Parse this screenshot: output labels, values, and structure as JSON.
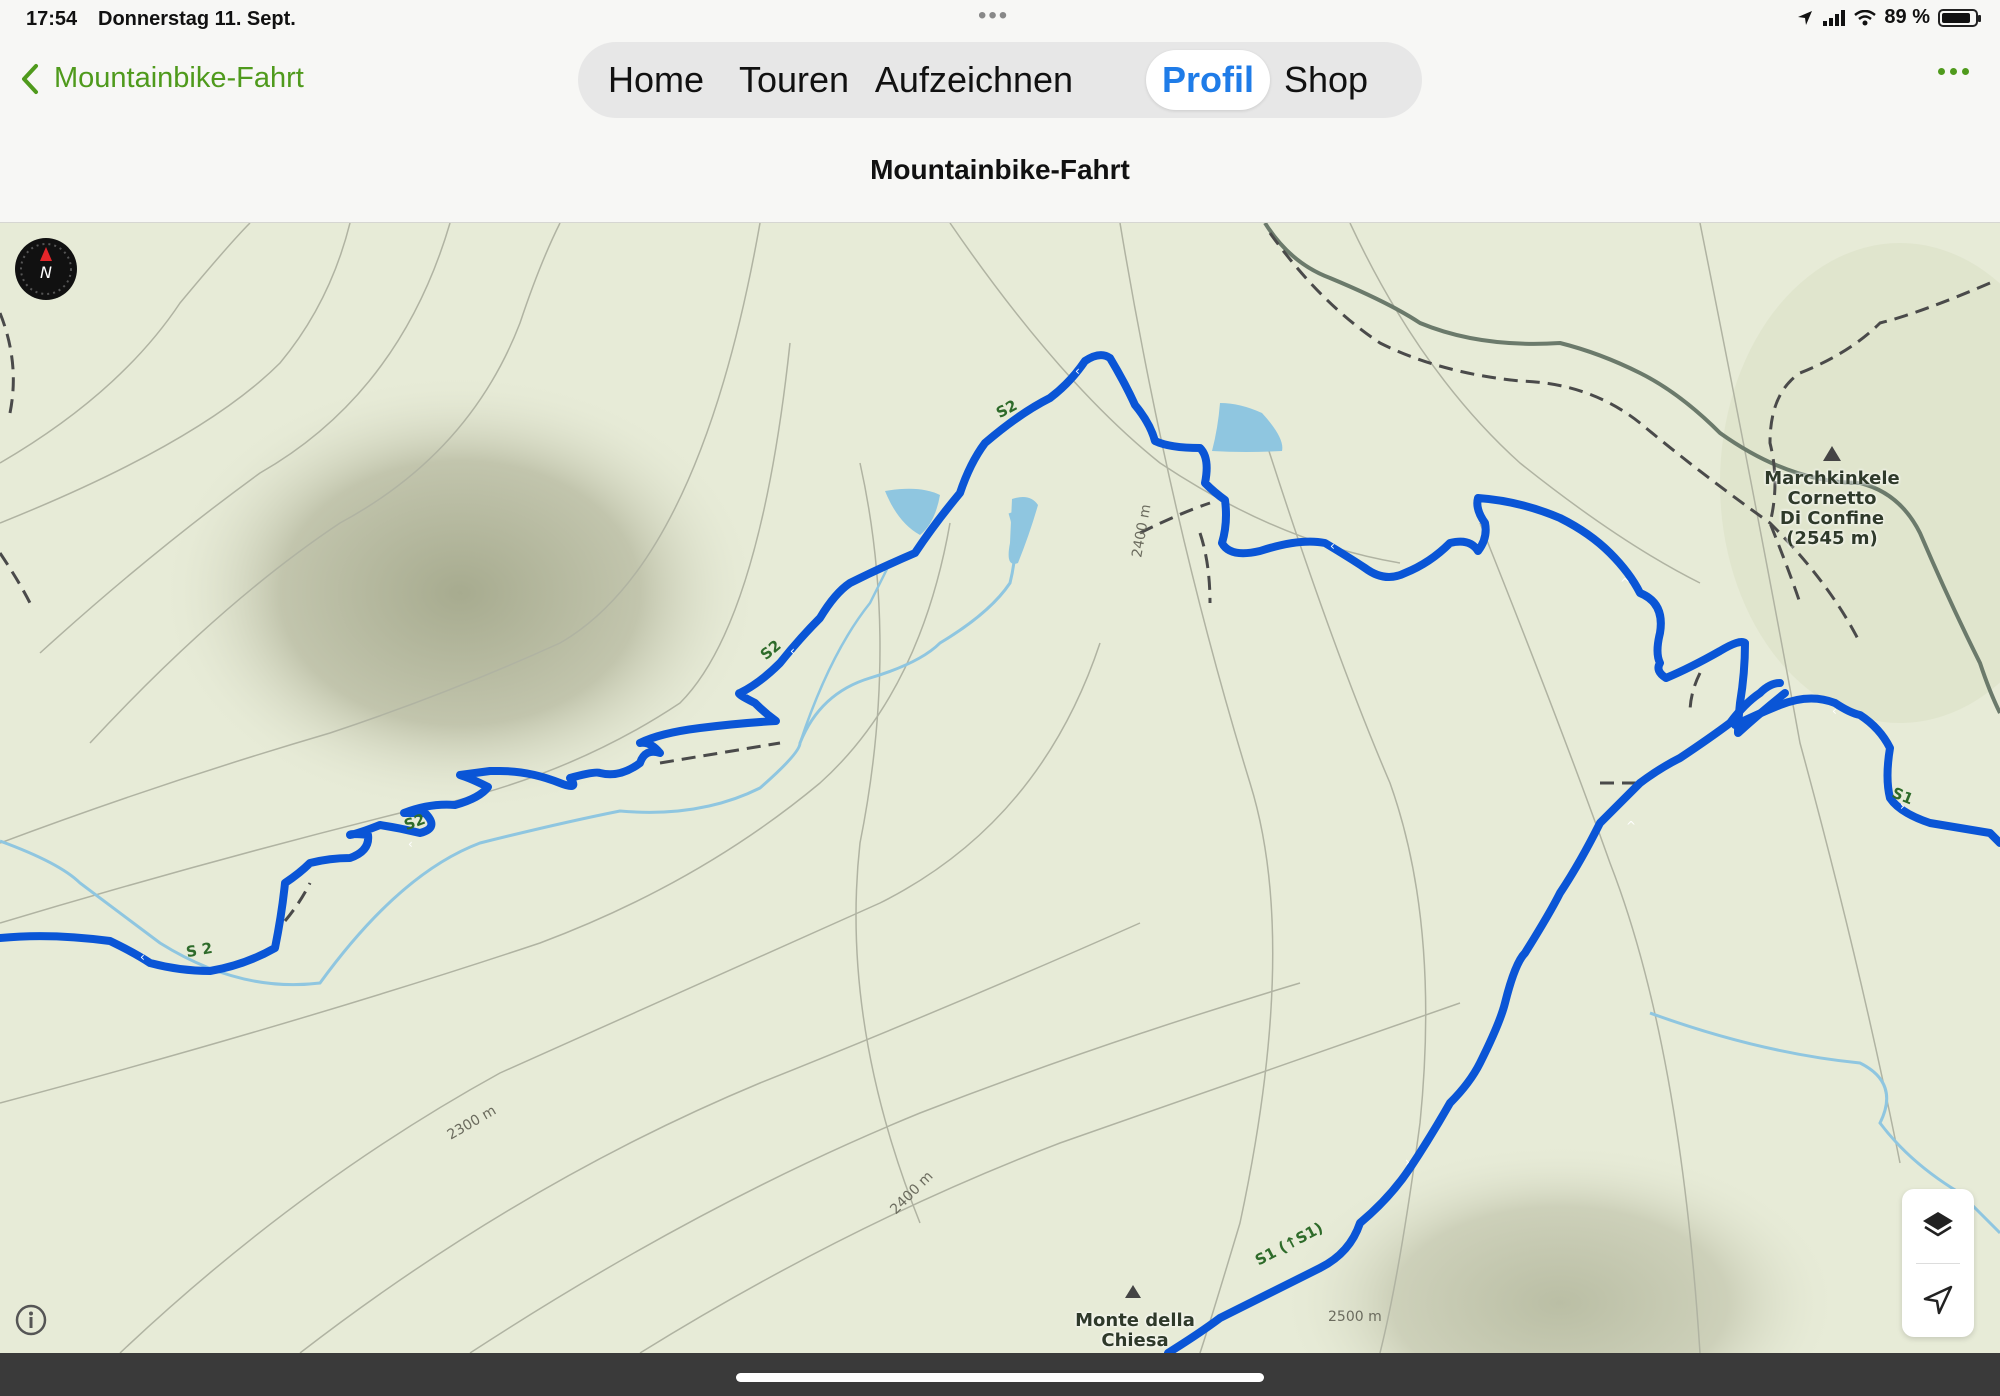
{
  "status_bar": {
    "time": "17:54",
    "date": "Donnerstag 11. Sept.",
    "battery_text": "89 %",
    "battery_level": 0.89
  },
  "nav": {
    "back_label": "Mountainbike-Fahrt",
    "tabs": [
      {
        "label": "Home",
        "active": false
      },
      {
        "label": "Touren",
        "active": false
      },
      {
        "label": "Aufzeichnen",
        "active": false
      },
      {
        "label": "Profil",
        "active": true
      },
      {
        "label": "Shop",
        "active": false
      }
    ],
    "more_icon": "ellipsis-icon"
  },
  "page": {
    "title": "Mountainbike-Fahrt"
  },
  "map": {
    "summits": [
      {
        "name": "Marchkinkele",
        "line2": "Cornetto",
        "line3": "Di Confine",
        "elevation": "(2545 m)"
      },
      {
        "name": "Monte della",
        "line2": "Chiesa"
      }
    ],
    "contour_labels": [
      "2400 m",
      "2300 m",
      "2400 m",
      "2500 m"
    ],
    "trail_labels": [
      "S2",
      "S2",
      "S2",
      "S 2",
      "S1",
      "S1 (↑S1)"
    ],
    "compass_label": "N",
    "colors": {
      "route": "#0a55d6",
      "water": "#8fc6e0",
      "background": "#e7ebd7",
      "contour": "#b0b3a2",
      "path_dark": "#505050",
      "trail_label": "#2e6b2a",
      "accent": "#4f9a1c",
      "tab_active": "#1f7ce8"
    },
    "controls": [
      "layers-icon",
      "location-arrow-icon"
    ],
    "info_icon": "info-icon"
  }
}
